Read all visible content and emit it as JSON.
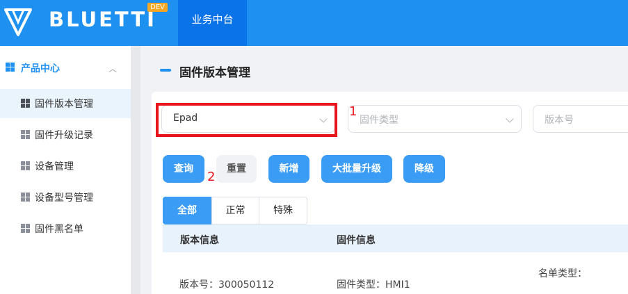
{
  "header": {
    "brand": "BLUETTI",
    "badge": "DEV",
    "active_nav": "业务中台"
  },
  "sidebar": {
    "group_label": "产品中心",
    "items": [
      {
        "label": "固件版本管理",
        "active": true
      },
      {
        "label": "固件升级记录",
        "active": false
      },
      {
        "label": "设备管理",
        "active": false
      },
      {
        "label": "设备型号管理",
        "active": false
      },
      {
        "label": "固件黑名单",
        "active": false
      }
    ]
  },
  "page": {
    "title": "固件版本管理"
  },
  "filters": {
    "product": {
      "value": "Epad"
    },
    "firmware_type": {
      "placeholder": "固件类型"
    },
    "version": {
      "placeholder": "版本号"
    }
  },
  "annotations": {
    "one": "1",
    "two": "2"
  },
  "buttons": {
    "query": "查询",
    "reset": "重置",
    "add": "新增",
    "bulk_upgrade": "大批量升级",
    "downgrade": "降级"
  },
  "tabs": [
    "全部",
    "正常",
    "特殊"
  ],
  "table": {
    "columns": [
      "版本信息",
      "固件信息"
    ],
    "row": {
      "version": "版本号：300050112",
      "firmware_type": "固件类型：HMI1",
      "list_type": "名单类型："
    }
  },
  "colors": {
    "primary": "#1e90f0",
    "annotation_red": "#e8141c"
  }
}
